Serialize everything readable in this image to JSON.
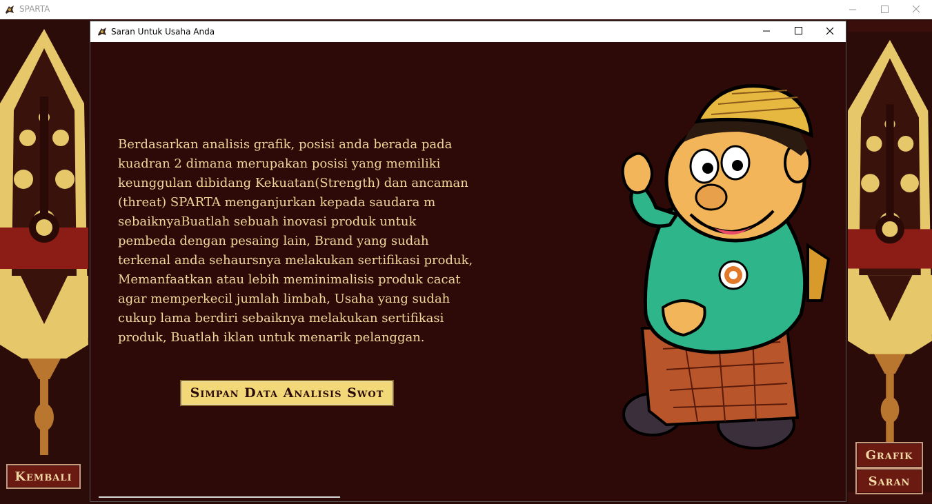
{
  "window": {
    "title": "SPARTA",
    "controls": [
      "minimize",
      "maximize",
      "close"
    ]
  },
  "dialog": {
    "title": "Saran Untuk Usaha Anda",
    "controls": [
      "minimize",
      "maximize",
      "close"
    ],
    "advice_text": "Berdasarkan analisis grafik, posisi anda berada pada kuadran 2 dimana merupakan posisi yang memiliki keunggulan dibidang Kekuatan(Strength) dan ancaman (threat) SPARTA menganjurkan kepada saudara m sebaiknyaBuatlah sebuah inovasi produk untuk pembeda dengan pesaing lain, Brand yang sudah terkenal anda sehaursnya melakukan sertifikasi produk, Memanfaatkan atau lebih meminimalisis produk cacat agar memperkecil jumlah limbah, Usaha yang sudah cukup lama berdiri sebaiknya melakukan sertifikasi produk, Buatlah iklan untuk menarik pelanggan.",
    "save_button": "Simpan Data Analisis Swot"
  },
  "left_panel": {
    "back_button": "Kembali"
  },
  "right_panel": {
    "chart_button": "Grafik",
    "advice_button": "Saran"
  },
  "colors": {
    "background": "#2d0a08",
    "text": "#f0d79a",
    "button_dark": "#6b1a12",
    "button_gold": "#f2d878"
  },
  "icons": {
    "app": "wayang-app-icon",
    "minimize": "minimize-icon",
    "maximize": "maximize-icon",
    "close": "close-icon"
  }
}
